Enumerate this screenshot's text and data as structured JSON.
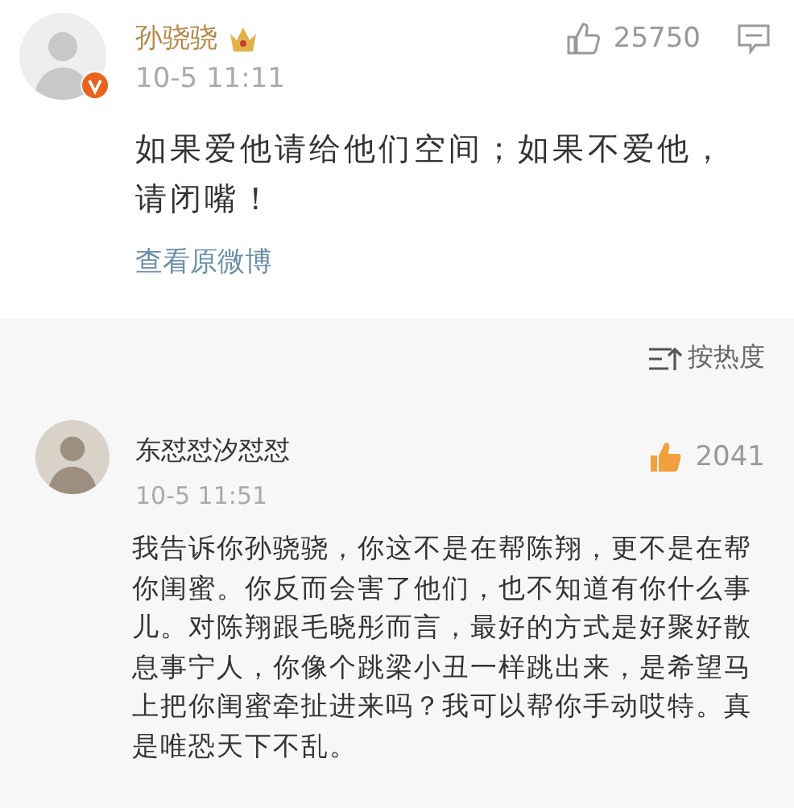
{
  "post": {
    "author": "孙骁骁",
    "verified": true,
    "likes": "25750",
    "liked": false,
    "time": "10-5 11:11",
    "text": "如果爱他请给他们空间；如果不爱他，请闭嘴！",
    "link": "查看原微博"
  },
  "sort": {
    "label": "按热度"
  },
  "comments": [
    {
      "author": "东怼怼汐怼怼",
      "time": "10-5 11:51",
      "likes": "2041",
      "liked": true,
      "text": "我告诉你孙骁骁，你这不是在帮陈翔，更不是在帮你闺蜜。你反而会害了他们，也不知道有你什么事儿。对陈翔跟毛晓彤而言，最好的方式是好聚好散息事宁人，你像个跳梁小丑一样跳出来，是希望马上把你闺蜜牵扯进来吗？我可以帮你手动哎特。真是唯恐天下不乱。"
    }
  ]
}
